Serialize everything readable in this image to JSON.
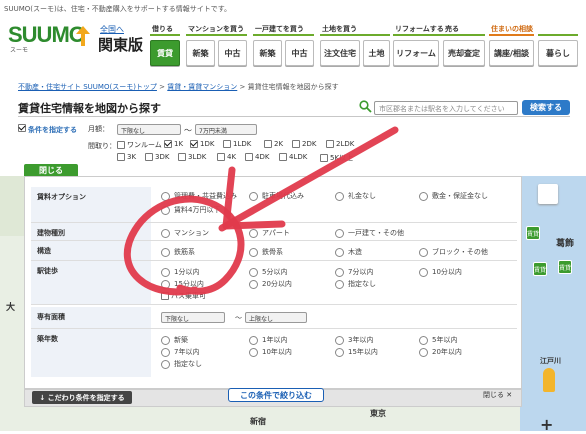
{
  "top_strip": {
    "text": "SUUMO(スーモ)は、住宅・不動産購入をサポートする情報サイトです。"
  },
  "logo": {
    "text": "SUUMO",
    "sub": "スーモ"
  },
  "region": {
    "link": "全国へ",
    "name": "関東版"
  },
  "nav": {
    "groups": [
      {
        "head": "借りる",
        "items": [
          "賃貸"
        ]
      },
      {
        "head": "マンションを買う",
        "items": [
          "新築",
          "中古"
        ]
      },
      {
        "head": "一戸建てを買う",
        "items": [
          "新築",
          "中古"
        ]
      },
      {
        "head": "土地を買う",
        "items": [
          "注文住宅",
          "土地"
        ]
      },
      {
        "head": "リフォームする",
        "items": [
          "リフォーム"
        ]
      },
      {
        "head": "売る",
        "items": [
          "売却査定"
        ]
      },
      {
        "head": "住まいの相談",
        "items": [
          "講座/相談"
        ]
      },
      {
        "head": "",
        "items": [
          "暮らし"
        ]
      }
    ]
  },
  "breadcrumb": {
    "items": [
      "不動産・住宅サイト SUUMO(スーモ)トップ",
      "賃貸・賃貸マンション",
      "賃貸住宅情報を地図から探す"
    ],
    "sep": ">"
  },
  "page_title": "賃貸住宅情報を地図から探す",
  "search": {
    "placeholder": "市区郡名または駅名を入力してください",
    "button": "検索する"
  },
  "conditions": {
    "toggle": "条件を指定する",
    "rent_label": "月額：",
    "rent_min": "下限なし",
    "tilde": "〜",
    "rent_max": "7万円未満",
    "layout_label": "間取り：",
    "layouts": [
      {
        "label": "ワンルーム",
        "checked": false
      },
      {
        "label": "1K",
        "checked": true
      },
      {
        "label": "1DK",
        "checked": true
      },
      {
        "label": "1LDK",
        "checked": false
      },
      {
        "label": "2K",
        "checked": false
      },
      {
        "label": "2DK",
        "checked": false
      },
      {
        "label": "2LDK",
        "checked": false
      },
      {
        "label": "3K",
        "checked": false
      },
      {
        "label": "3DK",
        "checked": false
      },
      {
        "label": "3LDK",
        "checked": false
      },
      {
        "label": "4K",
        "checked": false
      },
      {
        "label": "4DK",
        "checked": false
      },
      {
        "label": "4LDK",
        "checked": false
      },
      {
        "label": "5K以上",
        "checked": false
      }
    ]
  },
  "close_tab": "閉じる",
  "panel": {
    "rows": [
      {
        "label": "賃料オプション",
        "options": [
          "管理費・共益費込み",
          "駐車場代込み",
          "礼金なし",
          "敷金・保証金なし",
          "賃料4万円以下"
        ]
      },
      {
        "label": "建物種別",
        "options": [
          "マンション",
          "アパート",
          "一戸建て・その他"
        ]
      },
      {
        "label": "構造",
        "options": [
          "鉄筋系",
          "鉄骨系",
          "木造",
          "ブロック・その他"
        ]
      },
      {
        "label": "駅徒歩",
        "options": [
          "1分以内",
          "5分以内",
          "7分以内",
          "10分以内",
          "15分以内",
          "20分以内",
          "指定なし",
          "バス乗車可"
        ]
      },
      {
        "label": "専有面積",
        "area_min": "下限なし",
        "tilde": "〜",
        "area_max": "上限なし"
      },
      {
        "label": "築年数",
        "options": [
          "新築",
          "1年以内",
          "3年以内",
          "5年以内",
          "7年以内",
          "10年以内",
          "15年以内",
          "20年以内",
          "指定なし"
        ]
      }
    ],
    "detail_button": "こだわり条件を指定する",
    "apply_button": "この条件で絞り込む",
    "close_link": "閉じる"
  },
  "map": {
    "labels": [
      "大",
      "葛飾",
      "江戸川",
      "新宿",
      "東京"
    ],
    "pins": [
      "賃貸",
      "賃貸",
      "賃貸"
    ]
  },
  "icons": {
    "search": "search-icon",
    "arrow": "hand-drawn-arrow",
    "zoom": "zoom-in-icon",
    "pegman": "street-view-icon"
  },
  "colors": {
    "brand": "#3c9b2e",
    "link": "#1a5fb4",
    "annotation": "#e03a4c"
  }
}
